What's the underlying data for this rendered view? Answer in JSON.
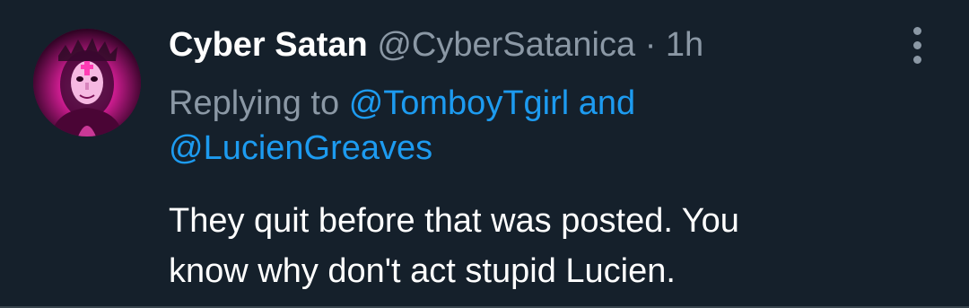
{
  "author": {
    "display_name": "Cyber Satan",
    "handle": "@CyberSatanica",
    "separator": "·",
    "timestamp": "1h",
    "avatar_icon": "profile-avatar"
  },
  "reply": {
    "prefix": "Replying to",
    "mention_1": "@TomboyTgirl",
    "conjunction": "and",
    "mention_2": "@LucienGreaves"
  },
  "tweet": {
    "text_line_1": "They quit before that was posted. You",
    "text_line_2": "know why don't act stupid Lucien."
  },
  "more_menu": {
    "icon": "more-vertical-icon"
  },
  "colors": {
    "background": "#15202b",
    "primary_text": "#ffffff",
    "secondary_text": "#8b98a5",
    "link": "#1d9bf0",
    "avatar_accent": "#f03bb0"
  }
}
